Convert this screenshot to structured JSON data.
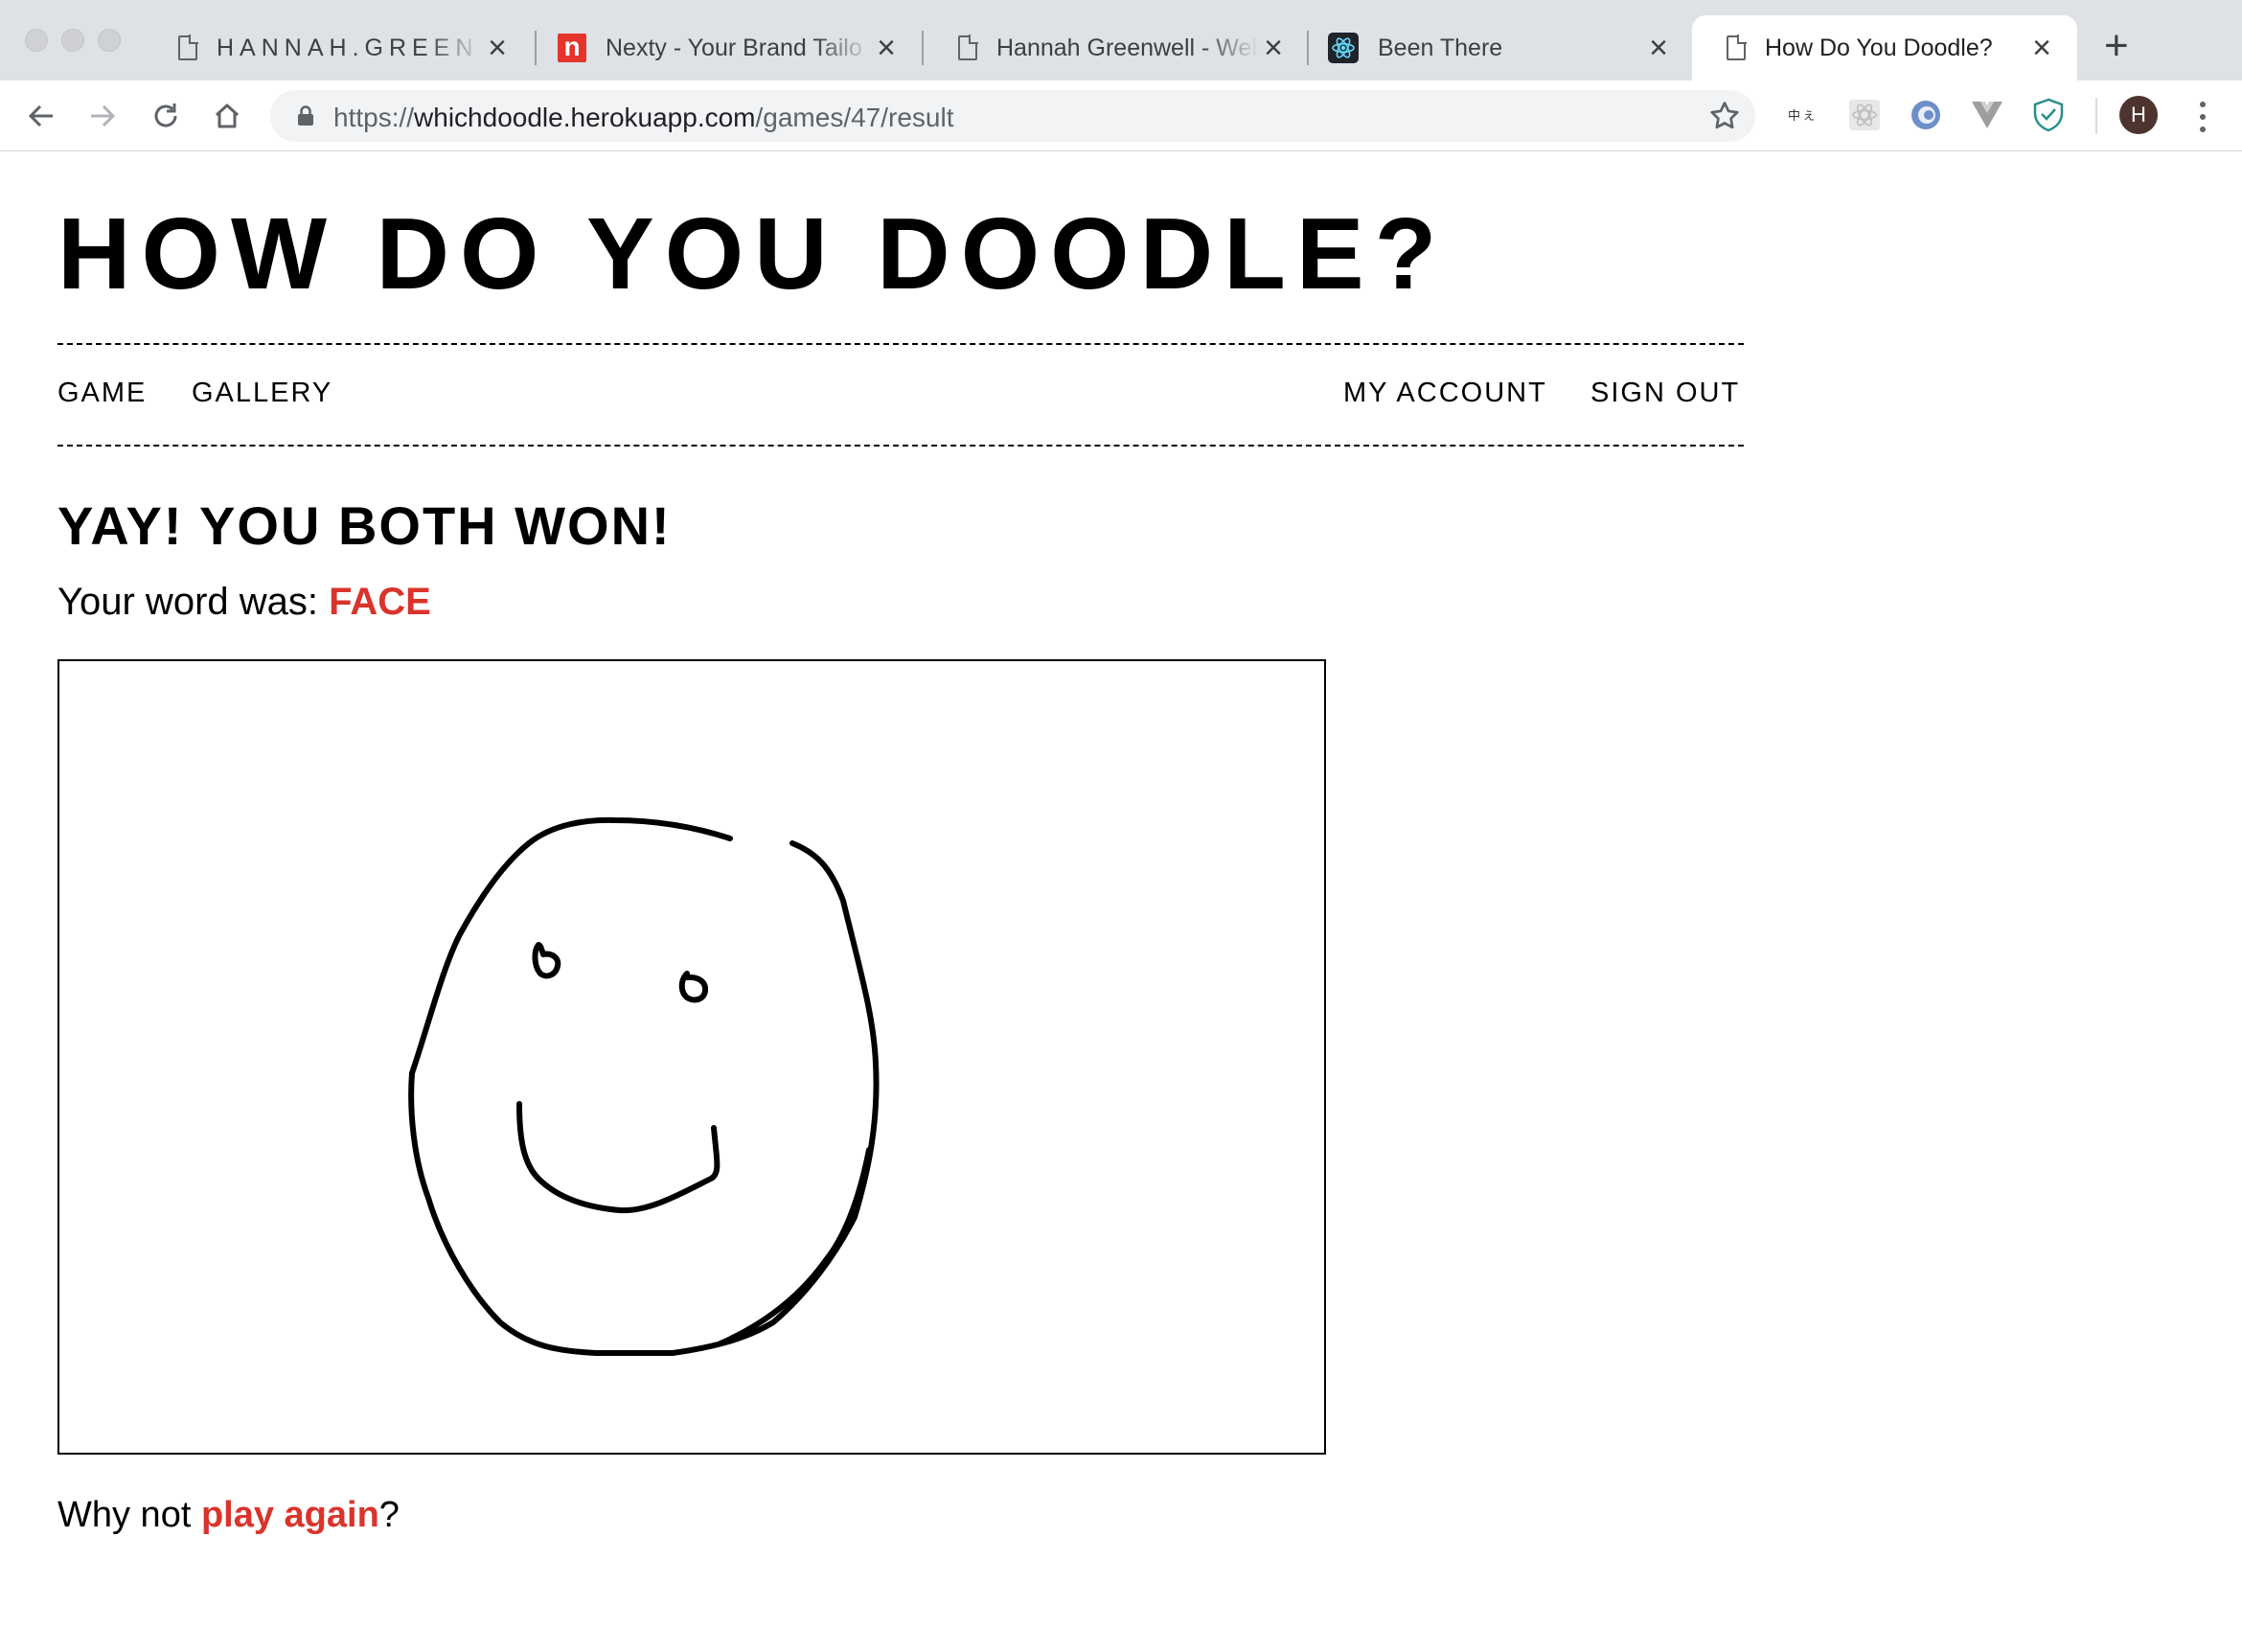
{
  "browser": {
    "tabs": [
      {
        "title": "HANNAH.GREEN",
        "favicon": "document-icon"
      },
      {
        "title": "Nexty - Your Brand Tailo",
        "favicon": "nexty-n-icon"
      },
      {
        "title": "Hannah Greenwell - Web",
        "favicon": "document-icon"
      },
      {
        "title": "Been There",
        "favicon": "react-atom-icon"
      },
      {
        "title": "How Do You Doodle?",
        "favicon": "document-icon",
        "active": true
      }
    ],
    "url": {
      "scheme": "https://",
      "host": "whichdoodle.herokuapp.com",
      "path": "/games/47/result"
    },
    "profile_initial": "H"
  },
  "site": {
    "title": "HOW DO YOU DOODLE?",
    "nav_left": [
      "GAME",
      "GALLERY"
    ],
    "nav_right": [
      "MY ACCOUNT",
      "SIGN OUT"
    ]
  },
  "result": {
    "headline": "YAY! YOU BOTH WON!",
    "word_prefix": "Your word was: ",
    "word": "FACE",
    "again_prefix": "Why not ",
    "again_link": "play again",
    "again_suffix": "?"
  },
  "doodle": {
    "depicts": "smiley-face-drawing",
    "stroke_color": "#000000"
  },
  "colors": {
    "accent_red": "#d9342b",
    "tabstrip_bg": "#dee1e6",
    "omnibox_bg": "#f1f3f4"
  }
}
